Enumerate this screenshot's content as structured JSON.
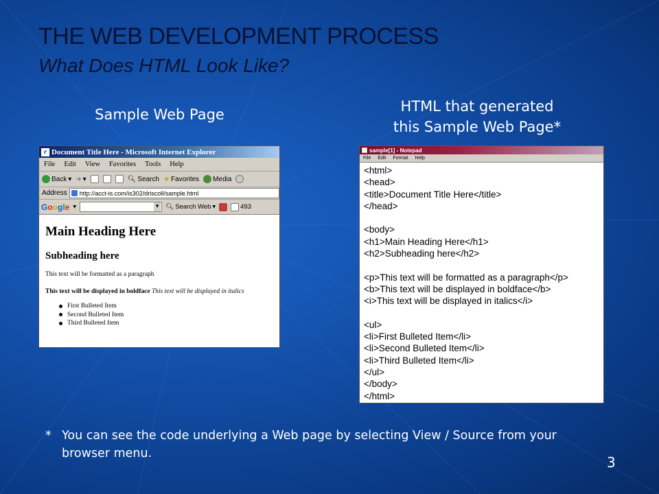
{
  "slide": {
    "title": "THE WEB DEVELOPMENT PROCESS",
    "subtitle": "What Does HTML Look Like?",
    "caption_left": "Sample Web Page",
    "caption_right_line1": "HTML that generated",
    "caption_right_line2": "this Sample Web Page*",
    "footnote_star": "*",
    "footnote_text": "You can see the code underlying a Web page by selecting View / Source from your browser menu.",
    "page_number": "3"
  },
  "colors": {
    "background": "#1452ad",
    "title": "#0b1230",
    "text": "#ffffff"
  },
  "browser": {
    "title": "Document Title Here - Microsoft Internet Explorer",
    "icon": "ie-icon",
    "menu": [
      "File",
      "Edit",
      "View",
      "Favorites",
      "Tools",
      "Help"
    ],
    "toolbar": {
      "back_label": "Back",
      "search_label": "Search",
      "favorites_label": "Favorites",
      "media_label": "Media"
    },
    "address_label": "Address",
    "address_value": "http://acct-is.com/is302/driscoll/sample.html",
    "google": {
      "logo": "Google",
      "search_web_label": "Search Web",
      "count": "493"
    },
    "content": {
      "h1": "Main Heading Here",
      "h2": "Subheading here",
      "paragraph": "This text will be formatted as a paragraph",
      "bold": "This text will be displayed in boldface",
      "italic": "This text will be displayed in italics",
      "list": [
        "First Bulleted Item",
        "Second Bulleted Item",
        "Third Bulleted Item"
      ]
    }
  },
  "notepad": {
    "title": "sample[1] - Notepad",
    "menu": [
      "File",
      "Edit",
      "Format",
      "Help"
    ],
    "lines": [
      "<html>",
      "<head>",
      "<title>Document Title Here</title>",
      "</head>",
      "",
      "<body>",
      "<h1>Main Heading Here</h1>",
      "<h2>Subheading here</h2>",
      "",
      "<p>This text will be formatted as a paragraph</p>",
      "<b>This text will be displayed in boldface</b>",
      "<i>This text will be displayed in italics</i>",
      "",
      "<ul>",
      "<li>First Bulleted Item</li>",
      "<li>Second Bulleted Item</li>",
      "<li>Third Bulleted Item</li>",
      "</ul>",
      "</body>",
      "</html>"
    ]
  }
}
